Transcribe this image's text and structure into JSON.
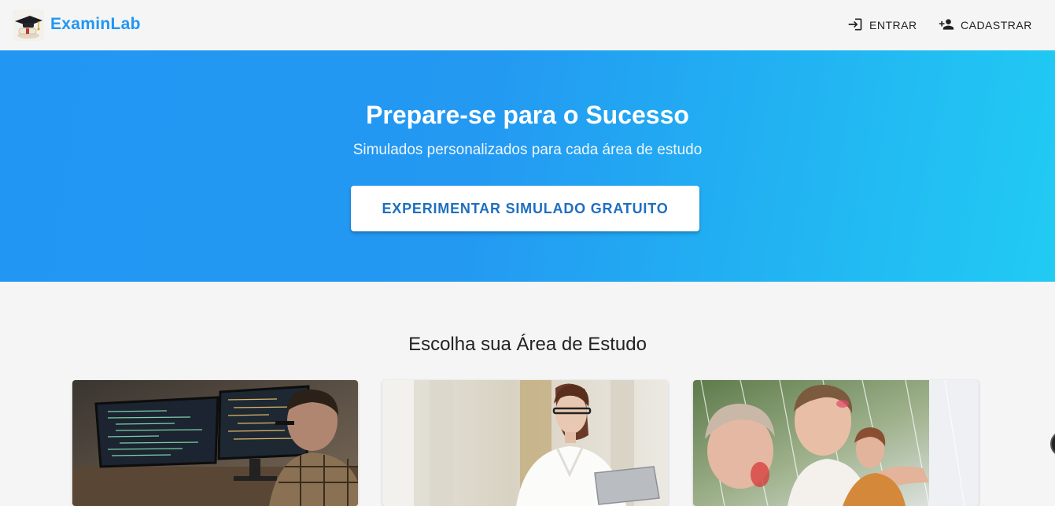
{
  "header": {
    "brand": "ExaminLab",
    "login_label": "ENTRAR",
    "signup_label": "CADASTRAR"
  },
  "hero": {
    "title": "Prepare-se para o Sucesso",
    "subtitle": "Simulados personalizados para cada área de estudo",
    "cta_label": "EXPERIMENTAR SIMULADO GRATUITO"
  },
  "areas": {
    "title": "Escolha sua Área de Estudo"
  },
  "colors": {
    "brand": "#2196f3",
    "gradient_start": "#2196f3",
    "gradient_end": "#21cbf3",
    "cta_text": "#1e6fbf"
  }
}
